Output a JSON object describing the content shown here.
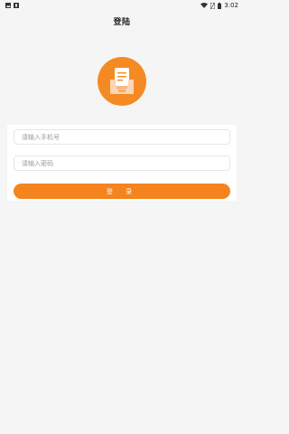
{
  "status_bar": {
    "time": "3:02",
    "icons": [
      "image-icon",
      "notification-icon",
      "wifi-icon",
      "no-sim-icon",
      "battery-icon"
    ]
  },
  "header": {
    "title": "登陆"
  },
  "logo": {
    "icon": "document-inbox-icon",
    "color": "#f58a24"
  },
  "form": {
    "phone_placeholder": "请输入手机号",
    "password_placeholder": "请输入密码",
    "login_label": "登 录",
    "accent_color": "#f5841f"
  }
}
